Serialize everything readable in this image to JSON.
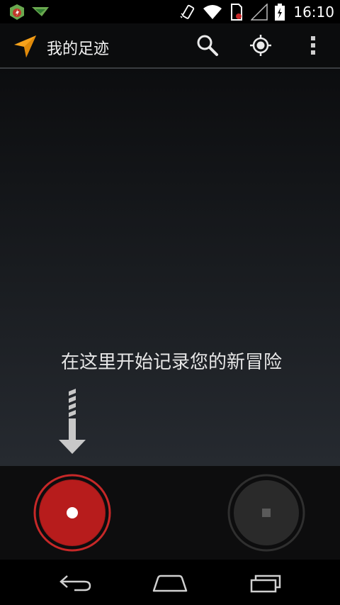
{
  "status_bar": {
    "time": "16:10",
    "icons": [
      "app-notification-icon",
      "download-notification-icon",
      "vibrate-icon",
      "wifi-icon",
      "sim-card-icon",
      "signal-icon",
      "battery-charging-icon"
    ]
  },
  "action_bar": {
    "title": "我的足迹",
    "app_icon": "navigation-arrow-icon",
    "actions": [
      "search-icon",
      "gps-locate-icon",
      "overflow-menu-icon"
    ]
  },
  "main": {
    "hint_text": "在这里开始记录您的新冒险"
  },
  "controls": {
    "record_icon": "record-icon",
    "stop_icon": "stop-icon"
  },
  "nav_bar": {
    "buttons": [
      "back-icon",
      "home-icon",
      "recents-icon"
    ]
  },
  "colors": {
    "accent": "#f7a21b",
    "record": "#b71c1c",
    "record_ring": "#d32f2f",
    "stop": "#2e2e2e"
  }
}
